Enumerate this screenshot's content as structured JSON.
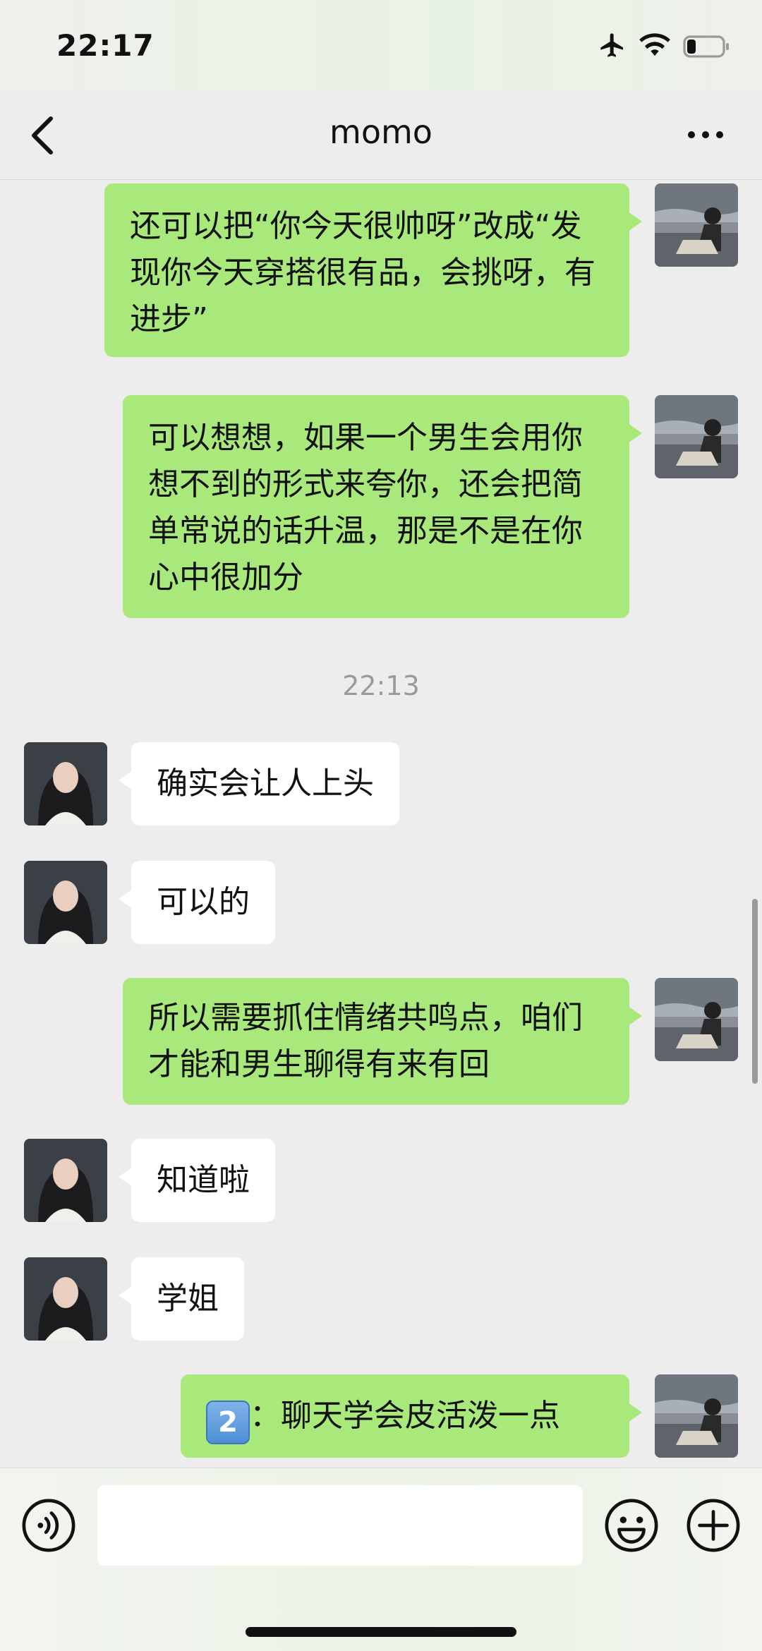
{
  "status_bar": {
    "time": "22:17"
  },
  "header": {
    "title": "momo"
  },
  "messages": [
    {
      "sender": "me",
      "text": "还可以把“你今天很帅呀”改成“发现你今天穿搭很有品，会挑呀，有进步”"
    },
    {
      "sender": "me",
      "text": "可以想想，如果一个男生会用你想不到的形式来夸你，还会把简单常说的话升温，那是不是在你心中很加分"
    },
    {
      "timestamp": "22:13"
    },
    {
      "sender": "momo",
      "text": "确实会让人上头"
    },
    {
      "sender": "momo",
      "text": "可以的"
    },
    {
      "sender": "me",
      "text": "所以需要抓住情绪共鸣点，咱们才能和男生聊得有来有回"
    },
    {
      "sender": "momo",
      "text": "知道啦"
    },
    {
      "sender": "momo",
      "text": "学姐"
    },
    {
      "sender": "me",
      "emoji": "2",
      "text": "：聊天学会皮活泼一点"
    }
  ],
  "input_bar": {
    "value": ""
  },
  "colors": {
    "my_bubble": "#a9e87a",
    "their_bubble": "#ffffff",
    "background": "#ededed"
  }
}
